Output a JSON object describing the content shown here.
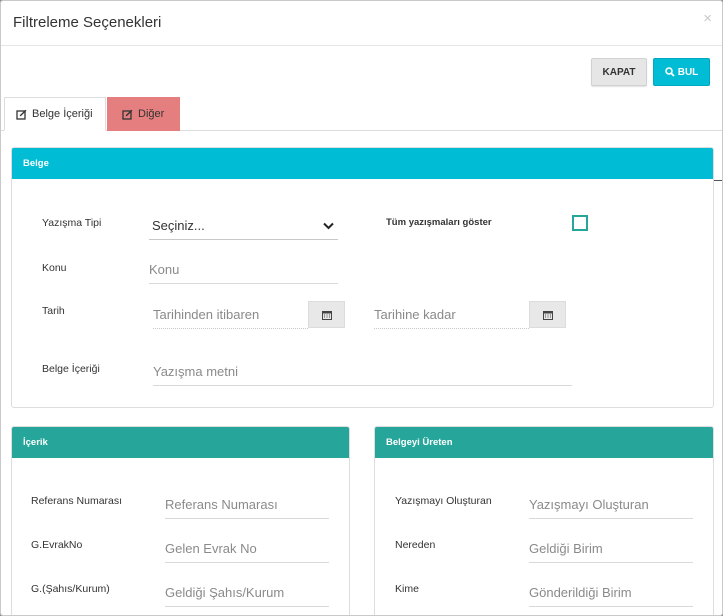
{
  "modal": {
    "title": "Filtreleme Seçenekleri",
    "close_glyph": "×"
  },
  "toolbar": {
    "close_label": "KAPAT",
    "find_label": "BUL"
  },
  "tabs": [
    {
      "label": "Belge İçeriği",
      "icon": "edit-square-icon",
      "active": true
    },
    {
      "label": "Diğer",
      "icon": "edit-square-icon",
      "active": false
    }
  ],
  "belge": {
    "title": "Belge",
    "yazisma_tipi_label": "Yazışma Tipi",
    "yazisma_tipi_value": "Seçiniz...",
    "tum_yazismalar_label": "Tüm yazışmaları göster",
    "konu_label": "Konu",
    "konu_placeholder": "Konu",
    "tarih_label": "Tarih",
    "tarih_from_placeholder": "Tarihinden itibaren",
    "tarih_to_placeholder": "Tarihine kadar",
    "icerik_label": "Belge İçeriği",
    "icerik_placeholder": "Yazışma metni"
  },
  "icerik": {
    "title": "İçerik",
    "ref_label": "Referans Numarası",
    "ref_placeholder": "Referans Numarası",
    "evrak_label": "G.EvrakNo",
    "evrak_placeholder": "Gelen Evrak No",
    "sahis_label": "G.(Şahıs/Kurum)",
    "sahis_placeholder": "Geldiği Şahıs/Kurum"
  },
  "uretici": {
    "title": "Belgeyi Üreten",
    "olusturan_label": "Yazışmayı Oluşturan",
    "olusturan_placeholder": "Yazışmayı Oluşturan",
    "nereden_label": "Nereden",
    "nereden_placeholder": "Geldiği Birim",
    "kime_label": "Kime",
    "kime_placeholder": "Gönderildiği Birim"
  },
  "colors": {
    "primary": "#00bcd4",
    "teal": "#26a69a",
    "danger_tab": "#e57f7f"
  }
}
